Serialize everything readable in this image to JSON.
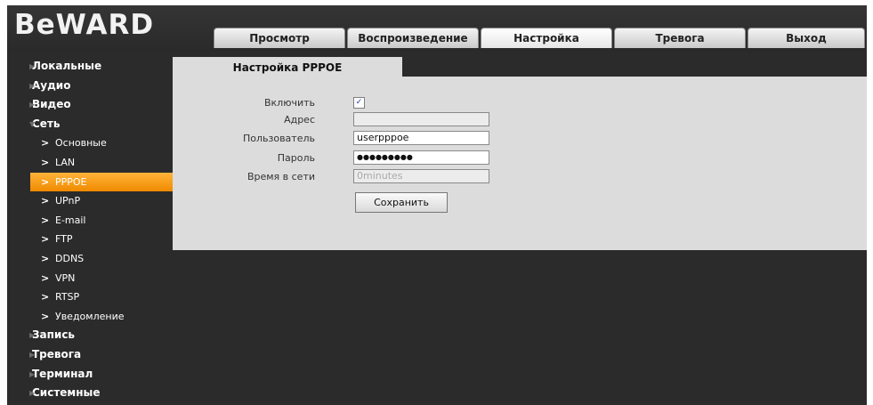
{
  "brand": {
    "logo_text": "BeWARD"
  },
  "tabs": [
    {
      "label": "Просмотр"
    },
    {
      "label": "Воспроизведение"
    },
    {
      "label": "Настройка"
    },
    {
      "label": "Тревога"
    },
    {
      "label": "Выход"
    }
  ],
  "active_tab": "Настройка",
  "sidebar": {
    "items": [
      {
        "label": "Локальные",
        "type": "main"
      },
      {
        "label": "Аудио",
        "type": "main"
      },
      {
        "label": "Видео",
        "type": "main"
      },
      {
        "label": "Сеть",
        "type": "main",
        "expanded": true
      },
      {
        "label": "Основные",
        "type": "sub"
      },
      {
        "label": "LAN",
        "type": "sub"
      },
      {
        "label": "PPPOE",
        "type": "sub",
        "active": true
      },
      {
        "label": "UPnP",
        "type": "sub"
      },
      {
        "label": "E-mail",
        "type": "sub"
      },
      {
        "label": "FTP",
        "type": "sub"
      },
      {
        "label": "DDNS",
        "type": "sub"
      },
      {
        "label": "VPN",
        "type": "sub"
      },
      {
        "label": "RTSP",
        "type": "sub"
      },
      {
        "label": "Уведомление",
        "type": "sub"
      },
      {
        "label": "Запись",
        "type": "main"
      },
      {
        "label": "Тревога",
        "type": "main"
      },
      {
        "label": "Терминал",
        "type": "main"
      },
      {
        "label": "Системные",
        "type": "main"
      }
    ]
  },
  "panel": {
    "title": "Настройка PPPOE",
    "enable_label": "Включить",
    "enable_checked": true,
    "address_label": "Адрес",
    "address_value": "",
    "user_label": "Пользователь",
    "user_value": "userpppoe",
    "password_label": "Пароль",
    "password_value": "●●●●●●●●●",
    "online_label": "Время в сети",
    "online_value": "0minutes",
    "save_label": "Сохранить"
  },
  "colors": {
    "accent": "#f39a10",
    "background": "#2b2b2b",
    "panel": "#dcdcdc"
  }
}
